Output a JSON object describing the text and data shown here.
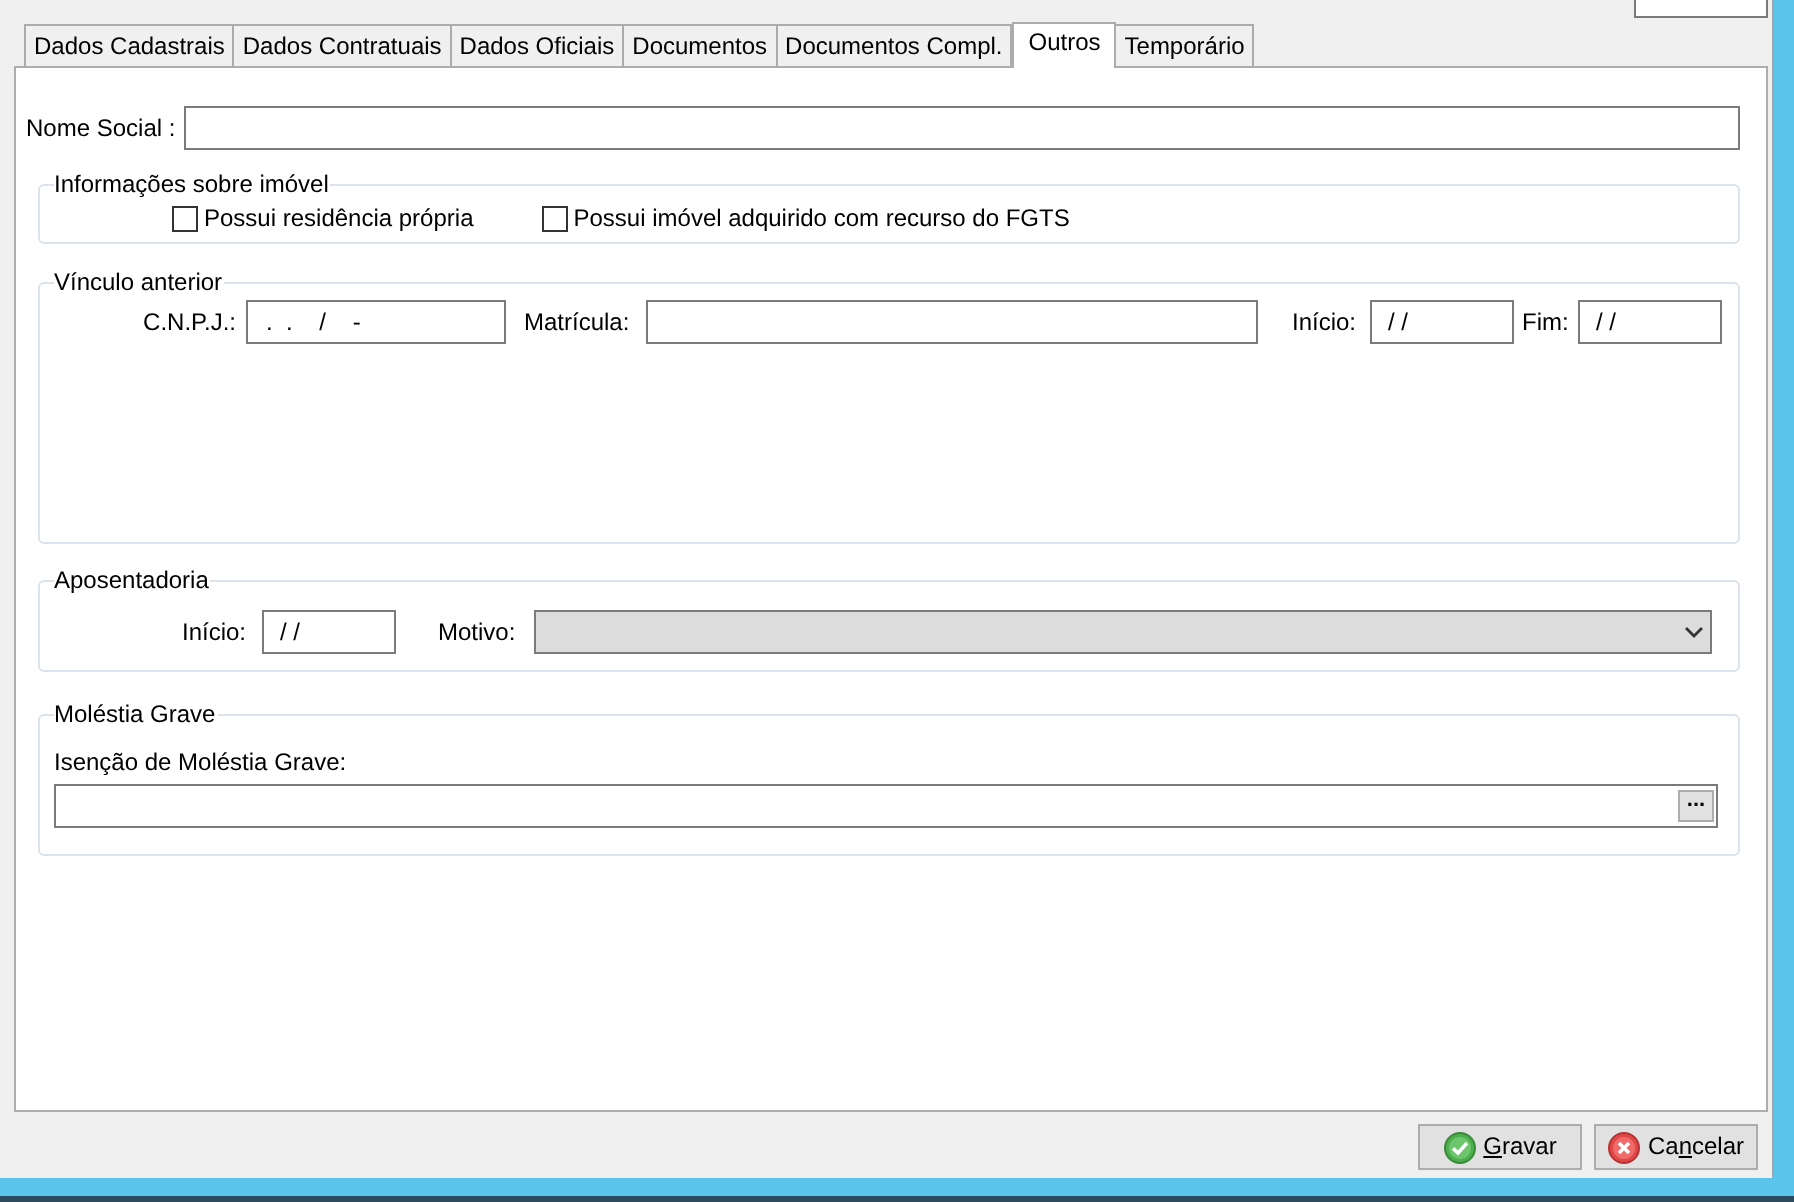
{
  "tabs": [
    {
      "label": "Dados Cadastrais",
      "selected": false
    },
    {
      "label": "Dados Contratuais",
      "selected": false
    },
    {
      "label": "Dados Oficiais",
      "selected": false
    },
    {
      "label": "Documentos",
      "selected": false
    },
    {
      "label": "Documentos Compl.",
      "selected": false
    },
    {
      "label": "Outros",
      "selected": true
    },
    {
      "label": "Temporário",
      "selected": false
    }
  ],
  "nome_social": {
    "label": "Nome Social :"
  },
  "imovel": {
    "title": "Informações sobre imóvel",
    "checkboxes": [
      {
        "label": "Possui residência própria",
        "checked": false
      },
      {
        "label": "Possui imóvel adquirido com recurso do FGTS",
        "checked": false
      }
    ]
  },
  "vinculo_anterior": {
    "title": "Vínculo anterior",
    "cnpj": {
      "label": "C.N.P.J.:",
      "value": ".  .    /    -"
    },
    "matricula": {
      "label": "Matrícula:"
    },
    "inicio": {
      "label": "Início:",
      "value": "/ /"
    },
    "fim": {
      "label": "Fim:",
      "value": "/ /"
    }
  },
  "aposentadoria": {
    "title": "Aposentadoria",
    "inicio": {
      "label": "Início:",
      "value": "/ /"
    },
    "motivo": {
      "label": "Motivo:",
      "disabled": true
    }
  },
  "molestia_grave": {
    "title": "Moléstia Grave",
    "isencao": {
      "label": "Isenção de Moléstia Grave:",
      "button": "..."
    }
  },
  "buttons": [
    {
      "kind": "save",
      "label_parts": [
        {
          "text": "G",
          "underline": true
        },
        {
          "text": "ravar",
          "underline": false
        }
      ]
    },
    {
      "kind": "cancel",
      "label_parts": [
        {
          "text": "Ca",
          "underline": false
        },
        {
          "text": "n",
          "underline": true
        },
        {
          "text": "celar",
          "underline": false
        }
      ]
    }
  ]
}
